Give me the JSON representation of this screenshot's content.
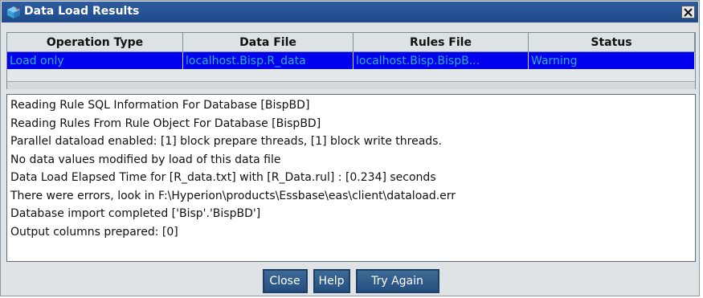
{
  "window": {
    "title": "Data Load Results",
    "icon": "cube-icon",
    "close_glyph": "✕"
  },
  "grid": {
    "columns": [
      "Operation Type",
      "Data File",
      "Rules File",
      "Status"
    ],
    "rows": [
      [
        "Load only",
        "localhost.Bisp.R_data",
        "localhost.Bisp.BispB...",
        "Warning"
      ]
    ],
    "selected_row_color": "#0000ee",
    "selected_text_color": "#2ab0c8"
  },
  "log": {
    "lines": [
      "Reading Rule SQL Information For Database [BispBD]",
      "Reading Rules From Rule Object For Database [BispBD]",
      "Parallel dataload enabled: [1] block prepare threads, [1] block write threads.",
      "No data values modified by load of this data file",
      "Data Load Elapsed Time for [R_data.txt] with [R_Data.rul] : [0.234] seconds",
      "There were errors, look in F:\\Hyperion\\products\\Essbase\\eas\\client\\dataload.err",
      "Database import completed ['Bisp'.'BispBD']",
      "Output columns prepared: [0]"
    ]
  },
  "buttons": {
    "close": "Close",
    "help": "Help",
    "try_again": "Try Again"
  },
  "colors": {
    "titlebar": "#1f4b8b",
    "button": "#2d5a8a"
  }
}
